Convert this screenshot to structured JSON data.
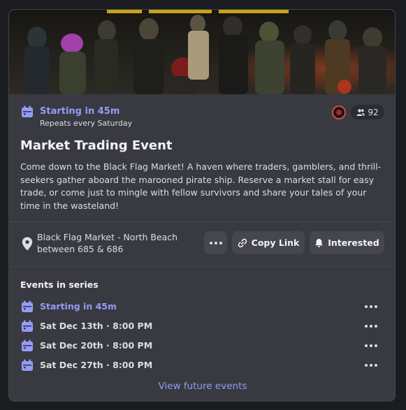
{
  "event": {
    "status": "Starting in 45m",
    "repeat_note": "Repeats every Saturday",
    "attendee_count": "92",
    "title": "Market Trading Event",
    "description": "Come down to the Black Flag Market! A haven where traders, gamblers, and thrill-seekers gather aboard the marooned pirate ship. Reserve a market stall for easy trade, or come just to mingle with fellow survivors and share your tales of your time in the wasteland!",
    "location_line1": "Black Flag Market - North Beach",
    "location_line2": "between 685 & 686"
  },
  "actions": {
    "more_label": "···",
    "copy_link_label": "Copy Link",
    "interested_label": "Interested"
  },
  "series": {
    "heading": "Events in series",
    "items": [
      {
        "label": "Starting in 45m"
      },
      {
        "label": "Sat Dec 13th · 8:00 PM"
      },
      {
        "label": "Sat Dec 20th · 8:00 PM"
      },
      {
        "label": "Sat Dec 27th · 8:00 PM"
      }
    ],
    "view_future_label": "View future events"
  },
  "icons": {
    "calendar": "calendar-icon",
    "location": "location-pin-icon",
    "link": "link-icon",
    "bell": "bell-icon",
    "people": "people-icon",
    "more": "more-dots-icon"
  },
  "colors": {
    "accent": "#949cf7",
    "card_bg": "#393a41",
    "page_bg": "#1b1c20",
    "button_bg": "#45464e",
    "text": "#dbdee1",
    "heading": "#f2f3f5"
  }
}
